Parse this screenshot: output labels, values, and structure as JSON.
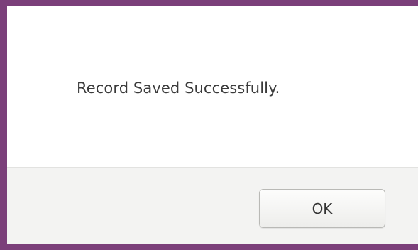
{
  "dialog": {
    "message": "Record Saved Successfully.",
    "ok_label": "OK"
  },
  "colors": {
    "desktop_background": "#7b3f7a",
    "dialog_background": "#ffffff",
    "button_bar_background": "#f3f3f2",
    "text": "#3a3a3a"
  }
}
